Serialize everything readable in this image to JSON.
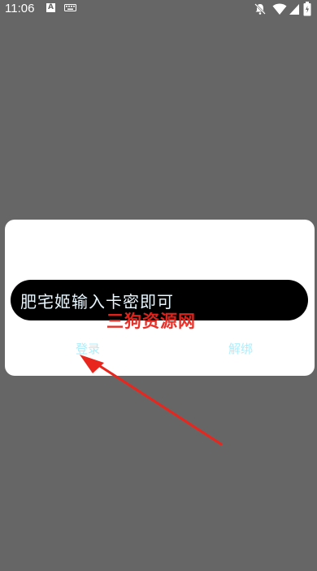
{
  "status_bar": {
    "time": "11:06",
    "a_icon_text": "A"
  },
  "dialog": {
    "input_text": "肥宅姬输入卡密即可",
    "login_label": "登录",
    "unbind_label": "解绑"
  },
  "watermark": "三狗资源网",
  "colors": {
    "background": "#666666",
    "dialog_bg": "#ffffff",
    "input_bg": "#000000",
    "button_text": "#aeeefc",
    "watermark": "#e8261e",
    "arrow": "#e8261e"
  }
}
